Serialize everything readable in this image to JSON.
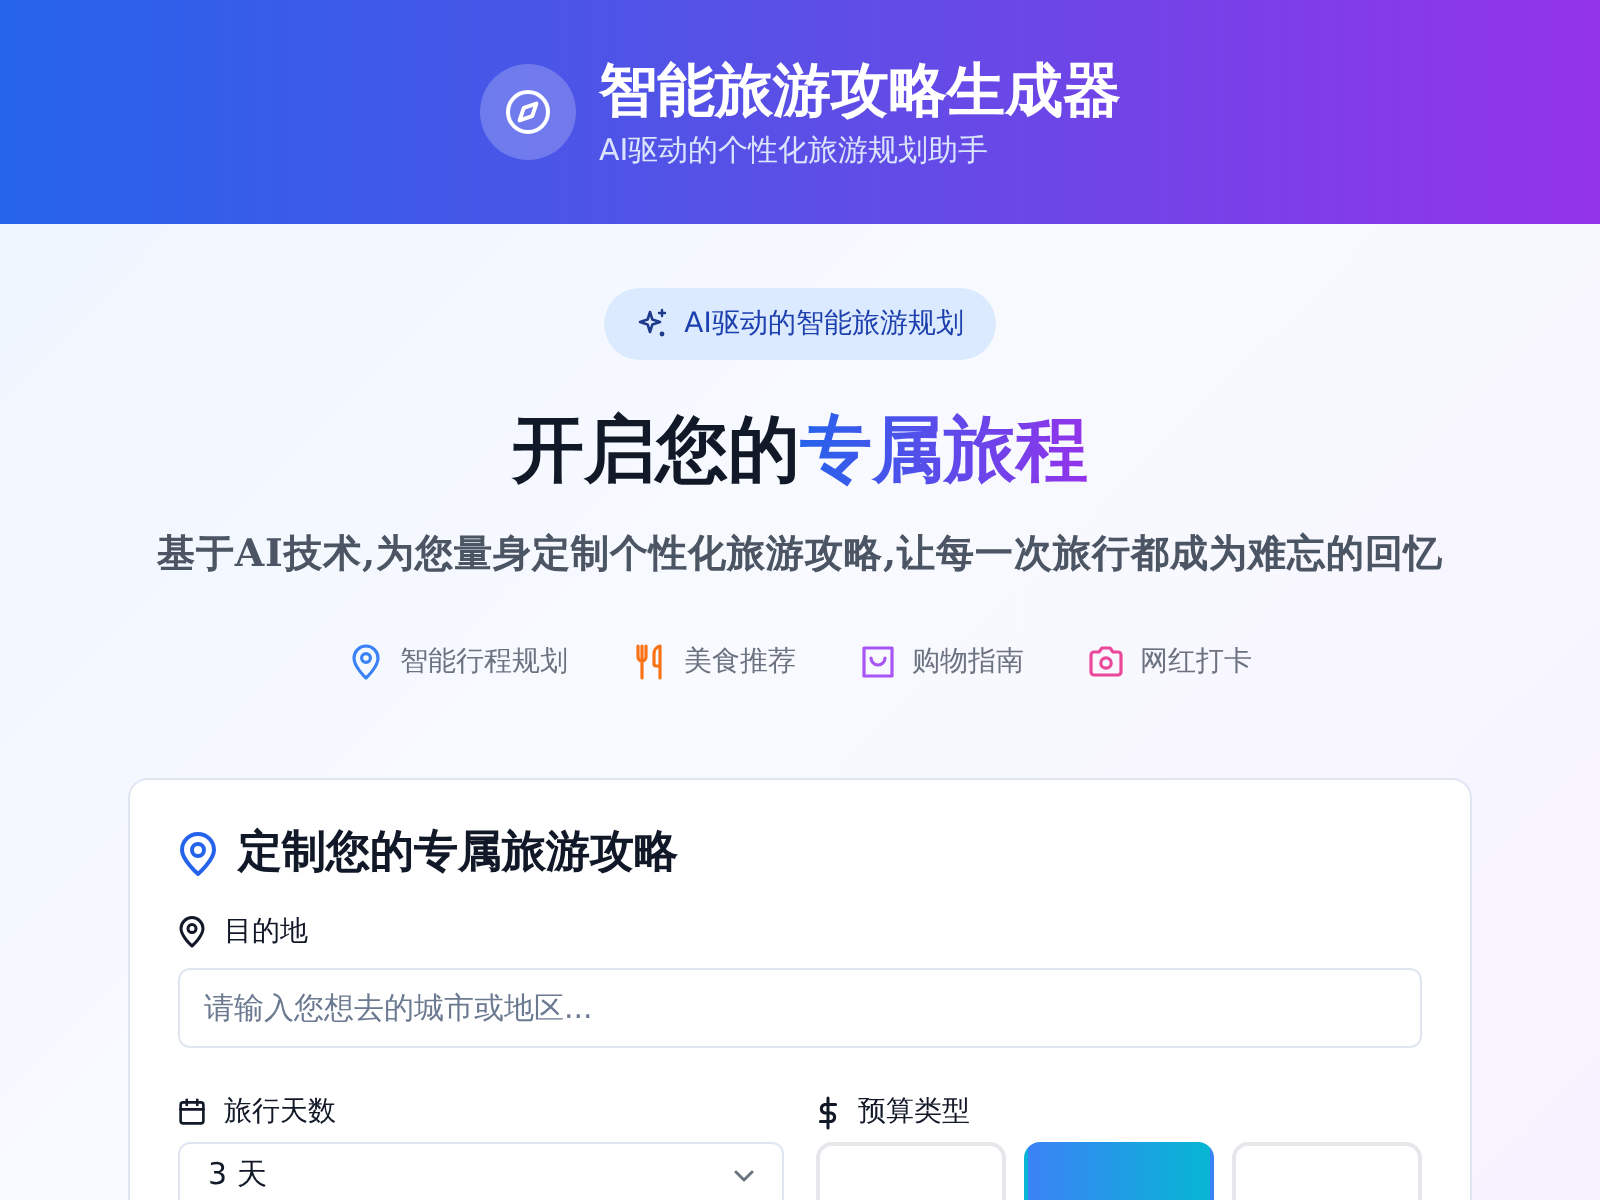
{
  "header": {
    "title": "智能旅游攻略生成器",
    "subtitle": "AI驱动的个性化旅游规划助手"
  },
  "hero": {
    "badge": "AI驱动的智能旅游规划",
    "heading": "开启您的",
    "heading_highlight": "专属旅程",
    "tagline": "基于AI技术,为您量身定制个性化旅游攻略,让每一次旅行都成为难忘的回忆",
    "features": [
      {
        "kind": "pin",
        "label": "智能行程规划",
        "color": "#3b82f6"
      },
      {
        "kind": "utensils",
        "label": "美食推荐",
        "color": "#f97316"
      },
      {
        "kind": "bag",
        "label": "购物指南",
        "color": "#a855f7"
      },
      {
        "kind": "camera",
        "label": "网红打卡",
        "color": "#ec4899"
      }
    ]
  },
  "form": {
    "title": "定制您的专属旅游攻略",
    "destination": {
      "label": "目的地",
      "placeholder": "请输入您想去的城市或地区..."
    },
    "days": {
      "label": "旅行天数",
      "value": "3 天"
    },
    "budget": {
      "label": "预算类型",
      "options": [
        {
          "selected": false
        },
        {
          "selected": true
        },
        {
          "selected": false
        }
      ]
    }
  }
}
